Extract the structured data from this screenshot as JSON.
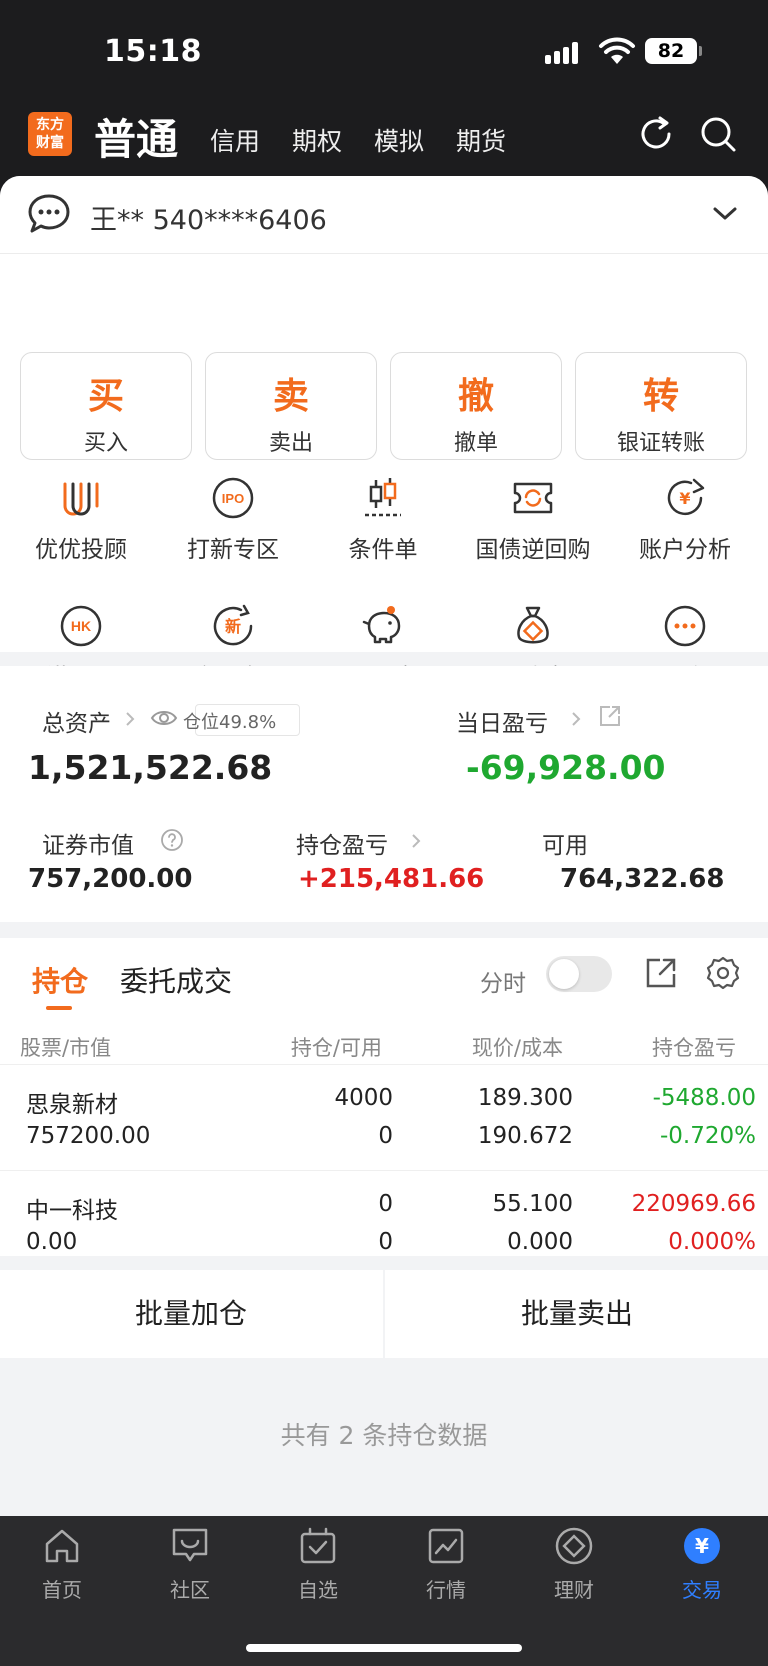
{
  "status": {
    "time": "15:18",
    "battery": "82"
  },
  "header": {
    "logo_line1": "东方",
    "logo_line2": "财富",
    "main_tab": "普通",
    "tabs": [
      "信用",
      "期权",
      "模拟",
      "期货"
    ]
  },
  "account": {
    "text": "王** 540****6406"
  },
  "actions": [
    {
      "glyph": "买",
      "label": "买入"
    },
    {
      "glyph": "卖",
      "label": "卖出"
    },
    {
      "glyph": "撤",
      "label": "撤单"
    },
    {
      "glyph": "转",
      "label": "银证转账"
    }
  ],
  "grid": [
    {
      "label": "优优投顾",
      "icon": "advisor-icon"
    },
    {
      "label": "打新专区",
      "icon": "ipo-icon",
      "icon_text": "IPO"
    },
    {
      "label": "条件单",
      "icon": "candlestick-icon"
    },
    {
      "label": "国债逆回购",
      "icon": "repo-ticket-icon"
    },
    {
      "label": "账户分析",
      "icon": "account-analysis-icon"
    },
    {
      "label": "港股通",
      "icon": "hk-icon",
      "icon_text": "HK"
    },
    {
      "label": "新三板",
      "icon": "new-third-board-icon",
      "icon_text": "新"
    },
    {
      "label": "天天宝",
      "icon": "piggy-bank-icon"
    },
    {
      "label": "固收宝",
      "icon": "money-bag-icon"
    },
    {
      "label": "更多",
      "icon": "more-icon"
    }
  ],
  "assets": {
    "total_label": "总资产",
    "position_label": "仓位49.8%",
    "total_value": "1,521,522.68",
    "daily_label": "当日盈亏",
    "daily_value": "-69,928.00",
    "market_label": "证券市值",
    "market_value": "757,200.00",
    "hold_pl_label": "持仓盈亏",
    "hold_pl_value": "+215,481.66",
    "avail_label": "可用",
    "avail_value": "764,322.68"
  },
  "holdings": {
    "tab_active": "持仓",
    "tab_other": "委托成交",
    "fenshi": "分时",
    "headers": [
      "股票/市值",
      "持仓/可用",
      "现价/成本",
      "持仓盈亏"
    ],
    "rows": [
      {
        "name": "思泉新材",
        "mv": "757200.00",
        "qty": "4000",
        "avail": "0",
        "price": "189.300",
        "cost": "190.672",
        "pl": "-5488.00",
        "plpct": "-0.720%"
      },
      {
        "name": "中一科技",
        "mv": "0.00",
        "qty": "0",
        "avail": "0",
        "price": "55.100",
        "cost": "0.000",
        "pl": "220969.66",
        "plpct": "0.000%"
      }
    ]
  },
  "batch": {
    "add": "批量加仓",
    "sell": "批量卖出"
  },
  "count_text": "共有 2 条持仓数据",
  "tabbar": [
    "首页",
    "社区",
    "自选",
    "行情",
    "理财",
    "交易"
  ],
  "colors": {
    "accent": "#f26b1d",
    "up": "#e02020",
    "down": "#1fa830",
    "active_tab": "#2f7fff"
  }
}
